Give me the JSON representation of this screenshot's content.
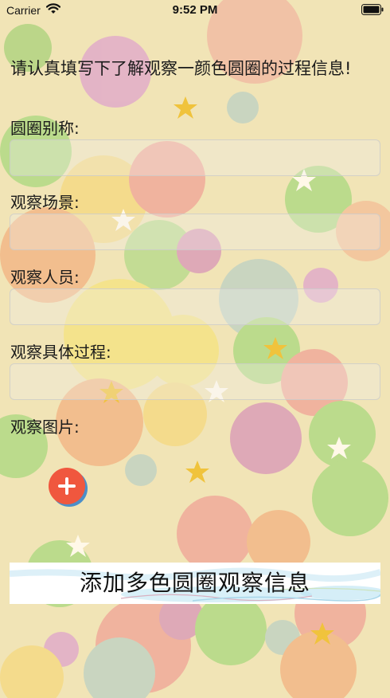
{
  "status_bar": {
    "carrier": "Carrier",
    "time": "9:52 PM"
  },
  "form": {
    "intro": "请认真填写下了解观察一颜色圆圈的过程信息!",
    "fields": [
      {
        "label": "圆圈别称:",
        "value": "",
        "placeholder": ""
      },
      {
        "label": "观察场景:",
        "value": "",
        "placeholder": ""
      },
      {
        "label": "观察人员:",
        "value": "",
        "placeholder": ""
      },
      {
        "label": "观察具体过程:",
        "value": "",
        "placeholder": ""
      }
    ],
    "photo_label": "观察图片:",
    "submit_label": "添加多色圆圈观察信息"
  },
  "icons": {
    "add_photo": "plus-icon",
    "wifi": "wifi-icon",
    "battery": "battery-icon"
  },
  "colors": {
    "background": "#f1e4b6",
    "add_button": "#f0573e",
    "add_button_shadow": "#4b8fc9",
    "text": "#1a1a1a"
  }
}
